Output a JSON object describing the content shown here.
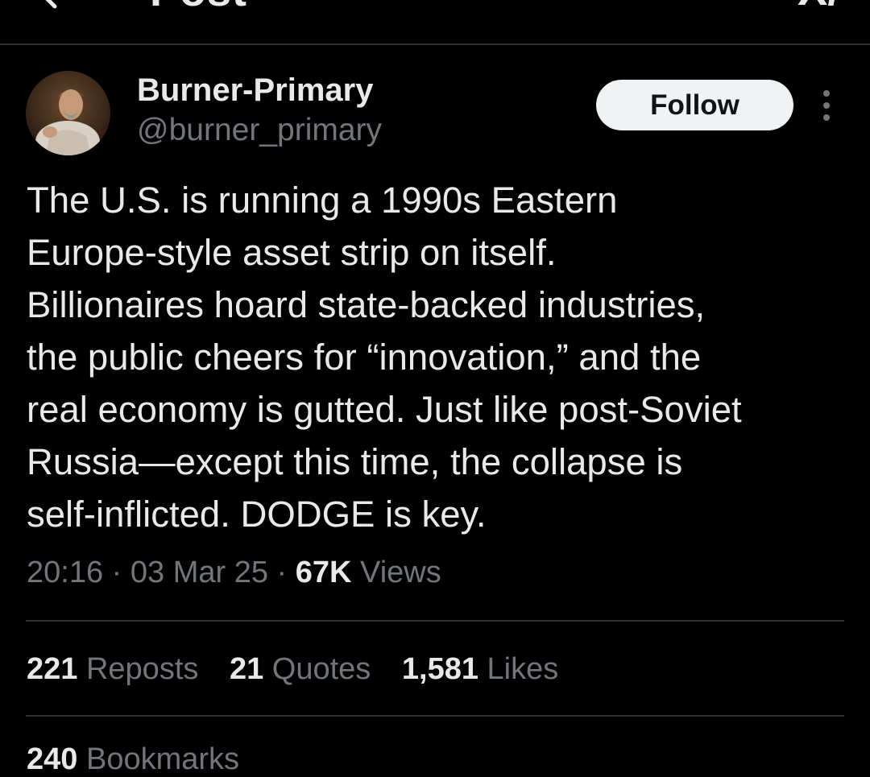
{
  "header": {
    "title": "Post",
    "back_icon": "arrow-left-icon",
    "grok_icon": "grok-icon",
    "grok_glyph": "X/"
  },
  "author": {
    "display_name": "Burner-Primary",
    "handle": "@burner_primary",
    "follow_label": "Follow"
  },
  "tweet": {
    "lines": [
      "The U.S. is running a 1990s Eastern",
      "Europe-style asset strip on itself.",
      "Billionaires hoard state-backed industries,",
      "the public cheers for “innovation,” and the",
      "real economy is gutted. Just like post-Soviet",
      "Russia—except this time, the collapse is",
      "self-inflicted. DODGE is key."
    ]
  },
  "meta": {
    "time": "20:16",
    "separator": "·",
    "date": "03 Mar 25",
    "views_count": "67K",
    "views_label": "Views"
  },
  "stats": {
    "reposts_count": "221",
    "reposts_label": "Reposts",
    "quotes_count": "21",
    "quotes_label": "Quotes",
    "likes_count": "1,581",
    "likes_label": "Likes",
    "bookmarks_count": "240",
    "bookmarks_label": "Bookmarks"
  },
  "colors": {
    "background": "#000000",
    "text_primary": "#e7e9ea",
    "text_secondary": "#71767b",
    "divider": "#2f3336",
    "follow_bg": "#eff3f4",
    "follow_text": "#0f1419"
  }
}
